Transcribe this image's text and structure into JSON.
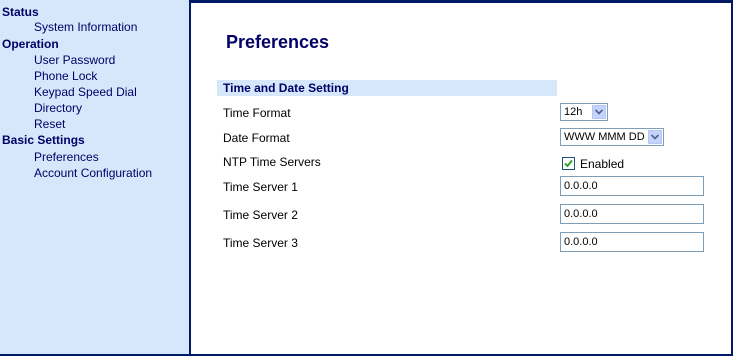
{
  "sidebar": {
    "sections": [
      {
        "label": "Status",
        "items": [
          "System Information"
        ]
      },
      {
        "label": "Operation",
        "items": [
          "User Password",
          "Phone Lock",
          "Keypad Speed Dial",
          "Directory",
          "Reset"
        ]
      },
      {
        "label": "Basic Settings",
        "items": [
          "Preferences",
          "Account Configuration"
        ]
      }
    ]
  },
  "main": {
    "title": "Preferences",
    "section_heading": "Time and Date Setting",
    "fields": {
      "time_format": {
        "label": "Time Format",
        "value": "12h"
      },
      "date_format": {
        "label": "Date Format",
        "value": "WWW MMM DD"
      },
      "ntp": {
        "label": "NTP Time Servers",
        "checked": true,
        "checkbox_label": "Enabled"
      },
      "server1": {
        "label": "Time Server 1",
        "value": "0.0.0.0"
      },
      "server2": {
        "label": "Time Server 2",
        "value": "0.0.0.0"
      },
      "server3": {
        "label": "Time Server 3",
        "value": "0.0.0.0"
      }
    }
  },
  "colors": {
    "nav_bg": "#d6e6fb",
    "nav_text": "#000066",
    "border": "#001a66"
  }
}
